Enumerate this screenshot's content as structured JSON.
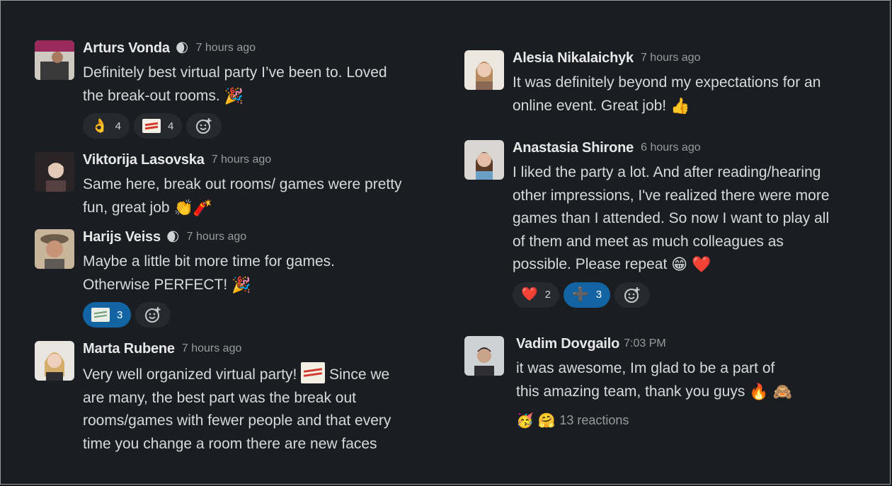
{
  "messages": [
    {
      "author": "Arturs Vonda",
      "status_icon": "🌒",
      "time": "7 hours ago",
      "lines": [
        "Definitely best virtual party I’ve been to. Loved",
        "the break-out rooms."
      ],
      "line_emoji": "🎉",
      "reactions": [
        {
          "icon": "👌",
          "count": "4"
        },
        {
          "icon": "sticker-red",
          "count": "4"
        }
      ]
    },
    {
      "author": "Viktorija Lasovska",
      "time": "7 hours ago",
      "lines": [
        "Same here, break out rooms/ games were pretty",
        "fun, great job"
      ],
      "line_emoji": "👏🧨"
    },
    {
      "author": "Harijs Veiss",
      "status_icon": "🌒",
      "time": "7 hours ago",
      "lines": [
        "Maybe a little bit more time for games.",
        "Otherwise PERFECT!"
      ],
      "line_emoji": "🎉",
      "reactions": [
        {
          "icon": "sticker-green",
          "count": "3",
          "active": true
        }
      ]
    },
    {
      "author": "Marta Rubene",
      "time": "7 hours ago",
      "lines": [
        "Very well organized virtual party!",
        "Since we",
        "are many, the best part was the break out",
        "rooms/games with fewer people and that every",
        "time you change a room there are new faces"
      ]
    },
    {
      "author": "Alesia Nikalaichyk",
      "time": "7 hours ago",
      "lines": [
        "It was definitely beyond my expectations for an",
        "online event. Great job!"
      ],
      "line_emoji": "👍"
    },
    {
      "author": "Anastasia Shirone",
      "time": "6 hours ago",
      "lines": [
        "I liked the party a lot. And after reading/hearing",
        "other impressions, I've realized there were more",
        "games than I attended. So now I want to play all",
        "of them and meet as much colleagues as",
        "possible. Please repeat"
      ],
      "line_emoji": "😁 ❤️",
      "reactions": [
        {
          "icon": "❤️",
          "count": "2"
        },
        {
          "icon": "➕",
          "count": "3",
          "active": true
        }
      ]
    },
    {
      "author": "Vadim Dovgailo",
      "time": "7:03 PM",
      "lines": [
        "it was awesome, Im glad to be a part of",
        "this amazing team, thank you guys"
      ],
      "line_emoji": "🔥 🙈",
      "reaction_summary": {
        "emojis": "🥳 🤗",
        "text": "13 reactions"
      }
    }
  ],
  "icons": {
    "add_reaction": "add-reaction-icon"
  },
  "colors": {
    "background": "#1a1d21",
    "active_reaction": "#1264a3",
    "pill": "#26292e"
  }
}
